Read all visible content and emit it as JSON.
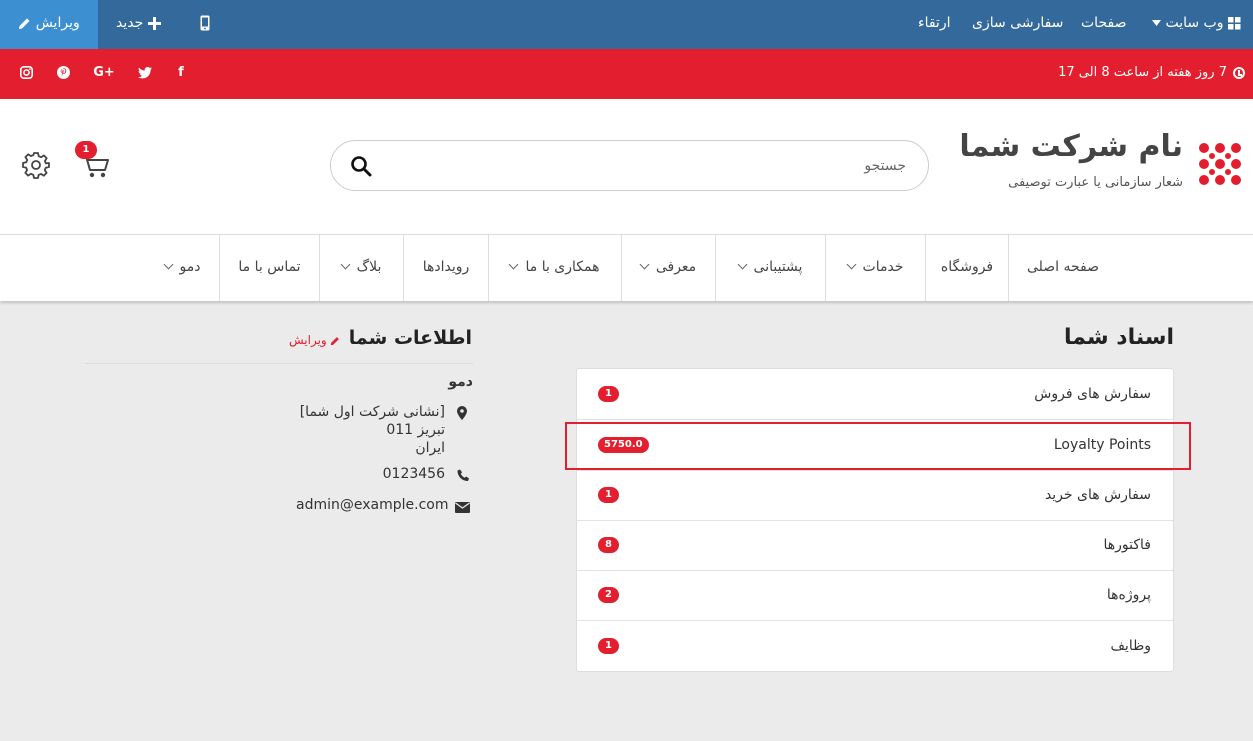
{
  "admin_bar": {
    "edit_label": "ویرایش",
    "new_label": "جدید",
    "website_label": "وب سایت",
    "pages_label": "صفحات",
    "customize_label": "سفارشی سازی",
    "upgrade_label": "ارتقاء"
  },
  "topbar": {
    "hours": "7 روز هفته از ساعت 8 الی 17",
    "social": [
      "facebook-icon",
      "twitter-icon",
      "google-plus-icon",
      "pinterest-icon",
      "instagram-icon"
    ]
  },
  "header": {
    "logo_title": "نام شرکت شما",
    "logo_subtitle": "شعار سازمانی یا عبارت توصیفی",
    "search_placeholder": "جستجو",
    "cart_count": "1"
  },
  "nav": {
    "items": [
      "صفحه اصلی",
      "فروشگاه",
      "خدمات",
      "پشتیبانی",
      "معرفی",
      "همکاری با ما",
      "رویدادها",
      "بلاگ",
      "تماس با ما",
      "دمو"
    ]
  },
  "documents": {
    "title": "اسناد شما",
    "rows": [
      {
        "label": "سفارش های فروش",
        "count": "1"
      },
      {
        "label": "Loyalty Points",
        "count": "5750.0"
      },
      {
        "label": "سفارش های خرید",
        "count": "1"
      },
      {
        "label": "فاکتورها",
        "count": "8"
      },
      {
        "label": "پروژه‌ها",
        "count": "2"
      },
      {
        "label": "وظایف",
        "count": "1"
      }
    ]
  },
  "info": {
    "title": "اطلاعات شما",
    "edit_label": "ویرایش",
    "name": "دمو",
    "address_line1": "[نشانی شرکت اول شما]",
    "address_line2": "تبریز 011",
    "address_line3": "ایران",
    "phone": "0123456",
    "email": "admin@example.com"
  },
  "colors": {
    "admin_bar": "#34699c",
    "admin_edit": "#3c8fd1",
    "brand_red": "#e31e2e"
  }
}
